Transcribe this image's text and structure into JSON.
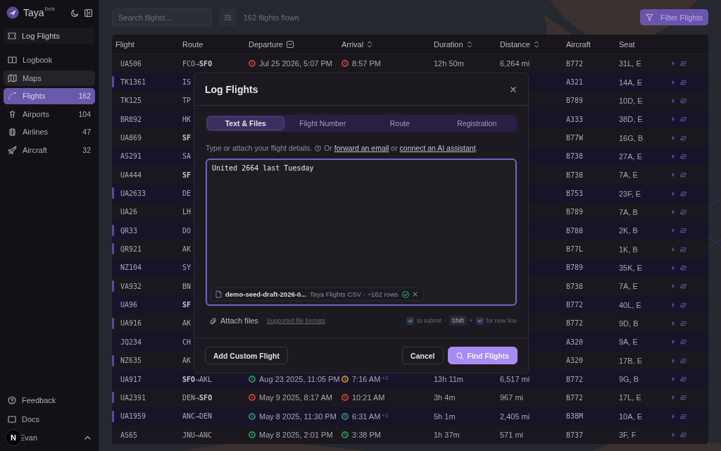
{
  "sidebar": {
    "brand": "Taya",
    "brand_badge": "Beta",
    "log_button": "Log Flights",
    "items": [
      {
        "label": "Logbook",
        "selected": false,
        "hovered": false
      },
      {
        "label": "Maps",
        "selected": false,
        "hovered": true
      },
      {
        "label": "Flights",
        "count": "162",
        "selected": true,
        "hovered": false
      },
      {
        "label": "Airports",
        "count": "104",
        "selected": false,
        "hovered": false
      },
      {
        "label": "Airlines",
        "count": "47",
        "selected": false,
        "hovered": false
      },
      {
        "label": "Aircraft",
        "count": "32",
        "selected": false,
        "hovered": false
      }
    ],
    "footer_items": [
      {
        "label": "Feedback"
      },
      {
        "label": "Docs"
      }
    ],
    "user": {
      "name": "Evan"
    },
    "dev_badge": "N"
  },
  "toolbar": {
    "search": {
      "placeholder": "Search flights..."
    },
    "summary": "162 flights flown",
    "filter_button": "Filter Flights"
  },
  "table": {
    "columns": [
      {
        "label": "Flight"
      },
      {
        "label": "Route"
      },
      {
        "label": "Departure",
        "sorted": true
      },
      {
        "label": "Arrival",
        "sortable": true
      },
      {
        "label": "Duration",
        "sortable": true
      },
      {
        "label": "Distance",
        "sortable": true
      },
      {
        "label": "Aircraft"
      },
      {
        "label": "Seat"
      }
    ],
    "rows": [
      {
        "flight": "UA506",
        "route": "FCO→**SFO**",
        "departure": {
          "time": "Jul 25 2026, 5:07 PM",
          "color": "#b8403f"
        },
        "arrival": {
          "time": "8:57 PM",
          "color": "#b8403f"
        },
        "duration": "12h 50m",
        "distance": "6,264 mi",
        "aircraft": "B772",
        "seat": "31L, E",
        "accent": false
      },
      {
        "flight": "TK1361",
        "route": "IS",
        "aircraft": "A321",
        "seat": "14A, E",
        "accent": true
      },
      {
        "flight": "TK125",
        "route": "TP",
        "aircraft": "B789",
        "seat": "10D, E",
        "accent": false
      },
      {
        "flight": "BR892",
        "route": "HK",
        "aircraft": "A333",
        "seat": "38D, E",
        "accent": false
      },
      {
        "flight": "UA869",
        "route": "**SF**",
        "aircraft": "B77W",
        "seat": "16G, B",
        "accent": false
      },
      {
        "flight": "AS291",
        "route": "SA",
        "aircraft": "B738",
        "seat": "27A, E",
        "accent": false
      },
      {
        "flight": "UA444",
        "route": "**SF**",
        "aircraft": "B738",
        "seat": "7A, E",
        "accent": false
      },
      {
        "flight": "UA2633",
        "route": "DE",
        "aircraft": "B753",
        "seat": "23F, E",
        "accent": true
      },
      {
        "flight": "UA26",
        "route": "LH",
        "aircraft": "B789",
        "seat": "7A, B",
        "accent": false
      },
      {
        "flight": "QR33",
        "route": "DO",
        "aircraft": "B788",
        "seat": "2K, B",
        "accent": true
      },
      {
        "flight": "QR921",
        "route": "AK",
        "aircraft": "B77L",
        "seat": "1K, B",
        "accent": true
      },
      {
        "flight": "NZ104",
        "route": "SY",
        "aircraft": "B789",
        "seat": "35K, E",
        "accent": false
      },
      {
        "flight": "VA932",
        "route": "BN",
        "aircraft": "B738",
        "seat": "7A, E",
        "accent": true
      },
      {
        "flight": "UA96",
        "route": "**SF**",
        "aircraft": "B772",
        "seat": "40L, E",
        "accent": false
      },
      {
        "flight": "UA916",
        "route": "AK",
        "aircraft": "B772",
        "seat": "9D, B",
        "accent": true
      },
      {
        "flight": "JQ234",
        "route": "CH",
        "aircraft": "A320",
        "seat": "9A, E",
        "accent": false
      },
      {
        "flight": "NZ635",
        "route": "AK",
        "aircraft": "A320",
        "seat": "17B, E",
        "accent": true
      },
      {
        "flight": "UA917",
        "route": "**SFO**→AKL",
        "departure": {
          "time": "Aug 23 2025, 11:05 PM",
          "color": "#2e8b5e"
        },
        "arrival": {
          "time": "7:16 AM",
          "color": "#b8862a",
          "day_offset": "+2"
        },
        "duration": "13h 11m",
        "distance": "6,517 mi",
        "aircraft": "B772",
        "seat": "9G, B",
        "accent": false
      },
      {
        "flight": "UA2391",
        "route": "DEN→**SFO**",
        "departure": {
          "time": "May 9 2025, 8:17 AM",
          "color": "#b8403f"
        },
        "arrival": {
          "time": "10:21 AM",
          "color": "#b8403f"
        },
        "duration": "3h 4m",
        "distance": "967 mi",
        "aircraft": "B772",
        "seat": "17L, E",
        "accent": true
      },
      {
        "flight": "UA1959",
        "route": "ANC→DEN",
        "departure": {
          "time": "May 8 2025, 11:30 PM",
          "color": "#2e8b5e"
        },
        "arrival": {
          "time": "6:31 AM",
          "color": "#2e8b5e",
          "day_offset": "+1"
        },
        "duration": "5h 1m",
        "distance": "2,405 mi",
        "aircraft": "B38M",
        "seat": "10A, E",
        "accent": true
      },
      {
        "flight": "AS65",
        "route": "JNU→ANC",
        "departure": {
          "time": "May 8 2025, 2:01 PM",
          "color": "#2e8b5e"
        },
        "arrival": {
          "time": "3:38 PM",
          "color": "#2e8b5e"
        },
        "duration": "1h 37m",
        "distance": "571 mi",
        "aircraft": "B737",
        "seat": "3F, F",
        "accent": false
      }
    ]
  },
  "dialog": {
    "title": "Log Flights",
    "tabs": [
      {
        "label": "Text & Files",
        "selected": true
      },
      {
        "label": "Flight Number",
        "selected": false
      },
      {
        "label": "Route",
        "selected": false
      },
      {
        "label": "Registration",
        "selected": false
      }
    ],
    "help_text": "Type or attach your flight details.",
    "help_prefix": "Or",
    "link_email": "forward an email",
    "help_middle": "or",
    "link_assistant": "connect an AI assistant",
    "help_end": ".",
    "message": {
      "value": "United 2664 last Tuesday"
    },
    "attachment": {
      "file_name": "demo-seed-draft-2026-0...",
      "details": "Taya Flights CSV · ~162 rows",
      "valid": true
    },
    "attach_button": "Attach files",
    "formats_link": "Supported file formats",
    "hints": {
      "submit": "to submit",
      "separator": "·",
      "shift_key": "Shift",
      "plus": "+",
      "newline": "for new line"
    },
    "buttons": {
      "custom": "Add Custom Flight",
      "cancel": "Cancel",
      "find": "Find Flights"
    }
  }
}
